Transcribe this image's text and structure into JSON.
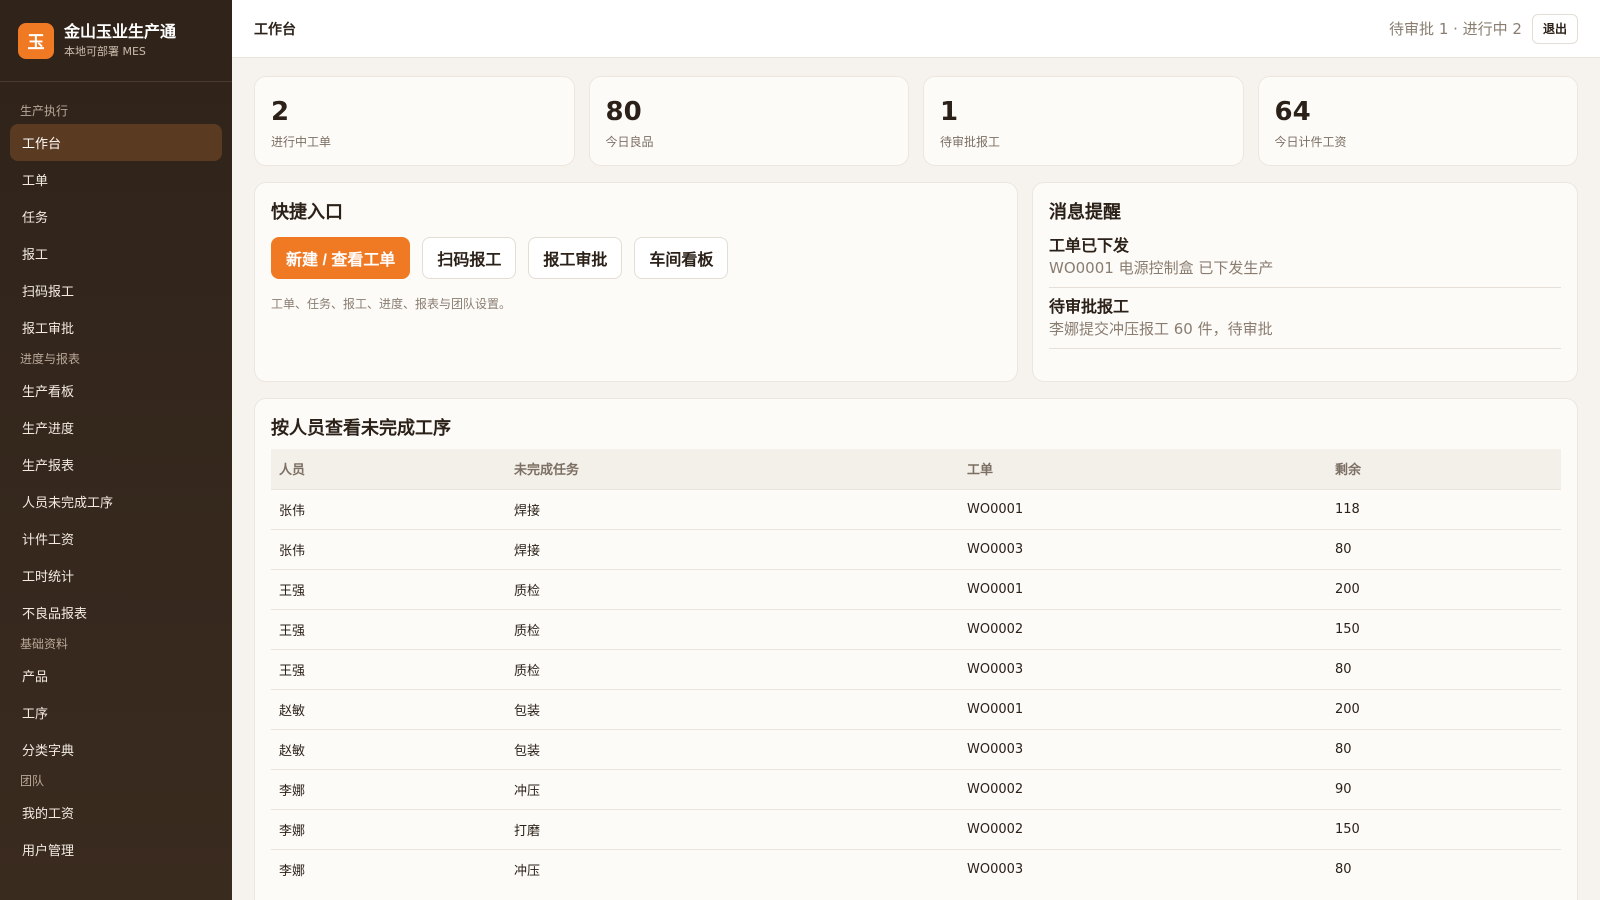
{
  "brand": {
    "logo_char": "玉",
    "title": "金山玉业生产通",
    "subtitle": "本地可部署 MES"
  },
  "sidebar": {
    "sections": [
      {
        "label": "生产执行",
        "items": [
          {
            "label": "工作台",
            "active": true
          },
          {
            "label": "工单"
          },
          {
            "label": "任务"
          },
          {
            "label": "报工"
          },
          {
            "label": "扫码报工"
          },
          {
            "label": "报工审批"
          }
        ]
      },
      {
        "label": "进度与报表",
        "items": [
          {
            "label": "生产看板"
          },
          {
            "label": "生产进度"
          },
          {
            "label": "生产报表"
          },
          {
            "label": "人员未完成工序"
          },
          {
            "label": "计件工资"
          },
          {
            "label": "工时统计"
          },
          {
            "label": "不良品报表"
          }
        ]
      },
      {
        "label": "基础资料",
        "items": [
          {
            "label": "产品"
          },
          {
            "label": "工序"
          },
          {
            "label": "分类字典"
          }
        ]
      },
      {
        "label": "团队",
        "items": [
          {
            "label": "我的工资"
          },
          {
            "label": "用户管理"
          }
        ]
      }
    ]
  },
  "topbar": {
    "title": "工作台",
    "status": "待审批 1 · 进行中 2",
    "logout_label": "退出"
  },
  "stats": [
    {
      "value": "2",
      "label": "进行中工单"
    },
    {
      "value": "80",
      "label": "今日良品"
    },
    {
      "value": "1",
      "label": "待审批报工"
    },
    {
      "value": "64",
      "label": "今日计件工资"
    }
  ],
  "quick": {
    "title": "快捷入口",
    "buttons": [
      {
        "label": "新建 / 查看工单",
        "primary": true
      },
      {
        "label": "扫码报工"
      },
      {
        "label": "报工审批"
      },
      {
        "label": "车间看板"
      }
    ],
    "description": "工单、任务、报工、进度、报表与团队设置。"
  },
  "messages": {
    "title": "消息提醒",
    "items": [
      {
        "title": "工单已下发",
        "body": "WO0001 电源控制盒 已下发生产"
      },
      {
        "title": "待审批报工",
        "body": "李娜提交冲压报工 60 件，待审批"
      }
    ]
  },
  "pending_table": {
    "title": "按人员查看未完成工序",
    "headers": [
      "人员",
      "未完成任务",
      "工单",
      "剩余"
    ],
    "rows": [
      [
        "张伟",
        "焊接",
        "WO0001",
        "118"
      ],
      [
        "张伟",
        "焊接",
        "WO0003",
        "80"
      ],
      [
        "王强",
        "质检",
        "WO0001",
        "200"
      ],
      [
        "王强",
        "质检",
        "WO0002",
        "150"
      ],
      [
        "王强",
        "质检",
        "WO0003",
        "80"
      ],
      [
        "赵敏",
        "包装",
        "WO0001",
        "200"
      ],
      [
        "赵敏",
        "包装",
        "WO0003",
        "80"
      ],
      [
        "李娜",
        "冲压",
        "WO0002",
        "90"
      ],
      [
        "李娜",
        "打磨",
        "WO0002",
        "150"
      ],
      [
        "李娜",
        "冲压",
        "WO0003",
        "80"
      ]
    ]
  },
  "colors": {
    "accent": "#f07a24",
    "sidebar_bg": "#2f231a",
    "sidebar_active": "#5a3b22"
  }
}
